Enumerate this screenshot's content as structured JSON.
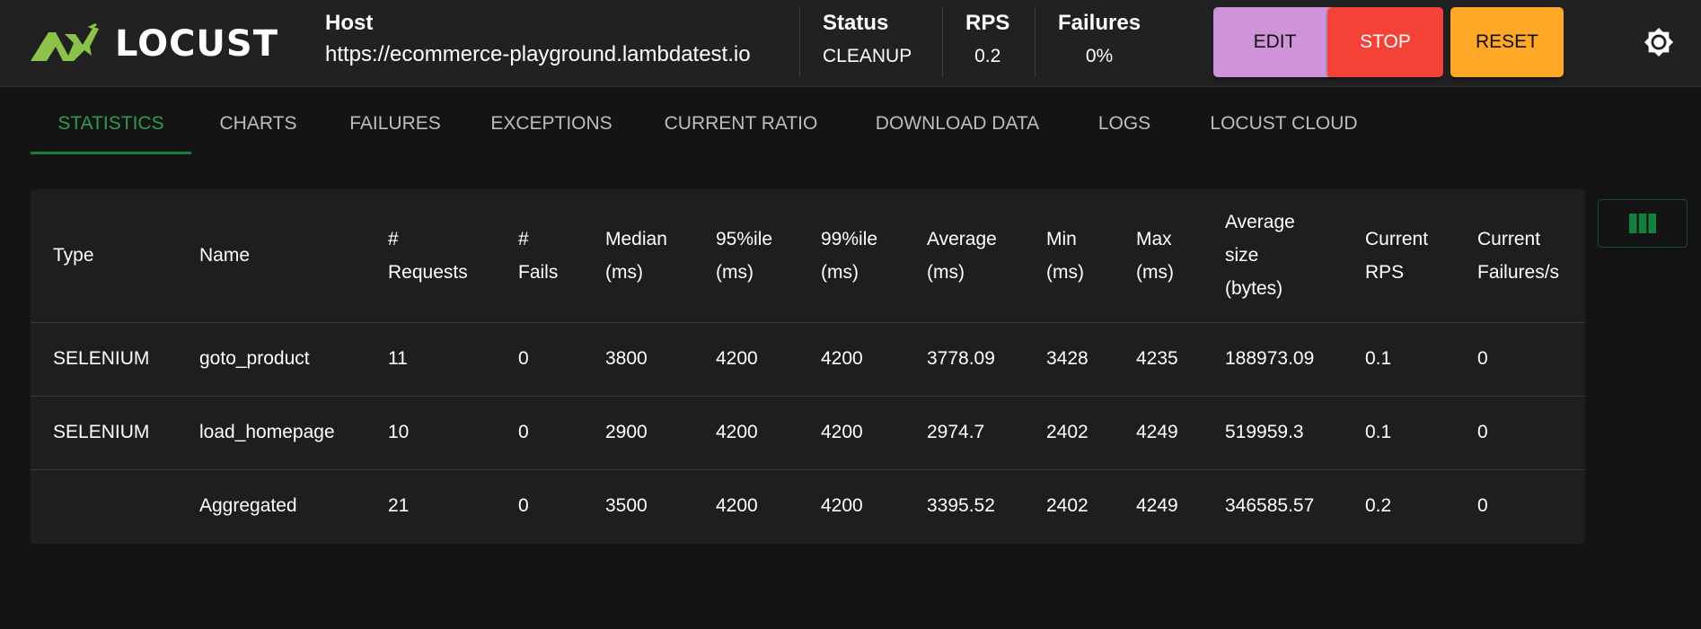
{
  "brand": {
    "name": "LOCUST",
    "accent": "#8bc34a"
  },
  "header": {
    "host_title": "Host",
    "host_value": "https://ecommerce-playground.lambdatest.io",
    "status_title": "Status",
    "status_value": "CLEANUP",
    "rps_title": "RPS",
    "rps_value": "0.2",
    "failures_title": "Failures",
    "failures_value": "0%"
  },
  "buttons": {
    "edit": "EDIT",
    "stop": "STOP",
    "reset": "RESET",
    "edit_color": "#ce93d8",
    "stop_color": "#f44336",
    "reset_color": "#ffa726"
  },
  "icons": {
    "theme": "sun-icon",
    "columns": "view-columns-icon"
  },
  "tabs": [
    {
      "label": "STATISTICS",
      "active": true
    },
    {
      "label": "CHARTS"
    },
    {
      "label": "FAILURES"
    },
    {
      "label": "EXCEPTIONS"
    },
    {
      "label": "CURRENT RATIO"
    },
    {
      "label": "DOWNLOAD DATA"
    },
    {
      "label": "LOGS"
    },
    {
      "label": "LOCUST CLOUD"
    }
  ],
  "table": {
    "headers": [
      "Type",
      "Name",
      "# Requests",
      "# Fails",
      "Median (ms)",
      "95%ile (ms)",
      "99%ile (ms)",
      "Average (ms)",
      "Min (ms)",
      "Max (ms)",
      "Average size (bytes)",
      "Current RPS",
      "Current Failures/s"
    ],
    "rows": [
      [
        "SELENIUM",
        "goto_product",
        "11",
        "0",
        "3800",
        "4200",
        "4200",
        "3778.09",
        "3428",
        "4235",
        "188973.09",
        "0.1",
        "0"
      ],
      [
        "SELENIUM",
        "load_homepage",
        "10",
        "0",
        "2900",
        "4200",
        "4200",
        "2974.7",
        "2402",
        "4249",
        "519959.3",
        "0.1",
        "0"
      ],
      [
        "",
        "Aggregated",
        "21",
        "0",
        "3500",
        "4200",
        "4200",
        "3395.52",
        "2402",
        "4249",
        "346585.57",
        "0.2",
        "0"
      ]
    ]
  }
}
